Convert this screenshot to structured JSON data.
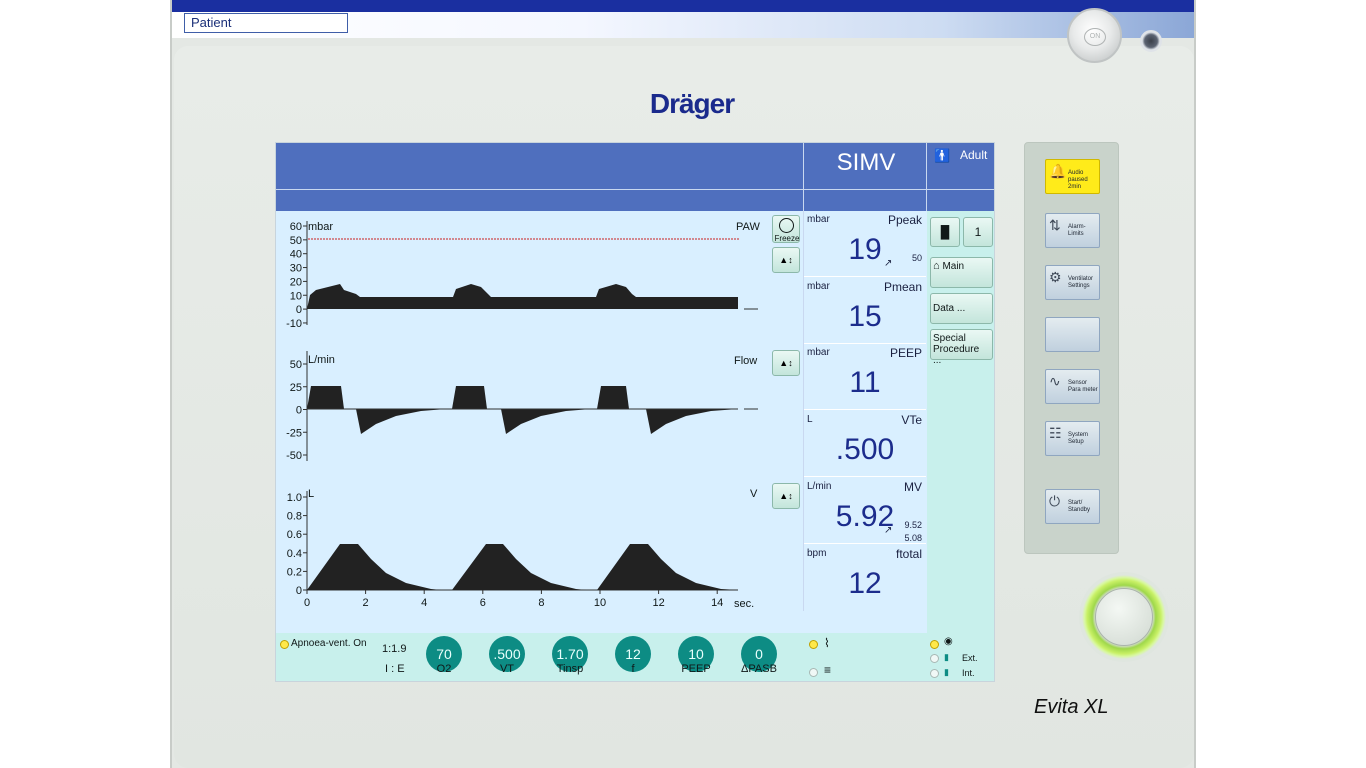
{
  "header": {
    "patient_field": "Patient"
  },
  "device": {
    "brand": "Dräger",
    "model": "Evita XL",
    "on_knob_label": "ON"
  },
  "screen": {
    "mode": "SIMV",
    "patient_category": "Adult",
    "waveforms": [
      {
        "unit": "mbar",
        "name": "PAW",
        "y_ticks": [
          "60",
          "50",
          "40",
          "30",
          "20",
          "10",
          "0",
          "-10"
        ],
        "alarm_limit": 50
      },
      {
        "unit": "L/min",
        "name": "Flow",
        "y_ticks": [
          "50",
          "25",
          "0",
          "-25",
          "-50"
        ]
      },
      {
        "unit": "L",
        "name": "V",
        "y_ticks": [
          "1.0",
          "0.8",
          "0.6",
          "0.4",
          "0.2",
          "0"
        ]
      }
    ],
    "x_ticks": [
      "0",
      "2",
      "4",
      "6",
      "8",
      "10",
      "12",
      "14"
    ],
    "x_unit": "sec.",
    "freeze_label": "Freeze",
    "measurements": [
      {
        "unit": "mbar",
        "name": "Ppeak",
        "value": "19",
        "limit": "50"
      },
      {
        "unit": "mbar",
        "name": "Pmean",
        "value": "15"
      },
      {
        "unit": "mbar",
        "name": "PEEP",
        "value": "11"
      },
      {
        "unit": "L",
        "name": "VTe",
        "value": ".500"
      },
      {
        "unit": "L/min",
        "name": "MV",
        "value": "5.92",
        "limit_high": "9.52",
        "limit_low": "5.08"
      },
      {
        "unit": "bpm",
        "name": "ftotal",
        "value": "12"
      }
    ],
    "side_buttons": {
      "main": "Main",
      "data": "Data ...",
      "special": "Special Procedure ...",
      "screen1": "1"
    },
    "settings": {
      "apnoea": "Apnoea-vent. On",
      "ie_value": "1:1.9",
      "ie_label": "I : E",
      "knobs": [
        {
          "value": "70",
          "label": "O2"
        },
        {
          "value": ".500",
          "label": "VT"
        },
        {
          "value": "1.70",
          "label": "Tinsp"
        },
        {
          "value": "12",
          "label": "f"
        },
        {
          "value": "10",
          "label": "PEEP"
        },
        {
          "value": "0",
          "label": "ΔPASB"
        }
      ],
      "ext_label": "Ext.",
      "int_label": "Int."
    }
  },
  "right_panel": {
    "audio": "Audio paused 2min",
    "alarm_limits": "Alarm-Limits",
    "ventilator_settings": "Ventilator Settings",
    "sensor_parameter": "Sensor Para meter",
    "system_setup": "System Setup",
    "start_standby": "Start/ Standby"
  },
  "colors": {
    "header_blue": "#4f6fbe",
    "screen_bg": "#d9efff",
    "knob_teal": "#0d8c84",
    "value_blue": "#1c2c8c",
    "led_yellow": "#ffe84a",
    "alarm_red": "#cc2222"
  }
}
